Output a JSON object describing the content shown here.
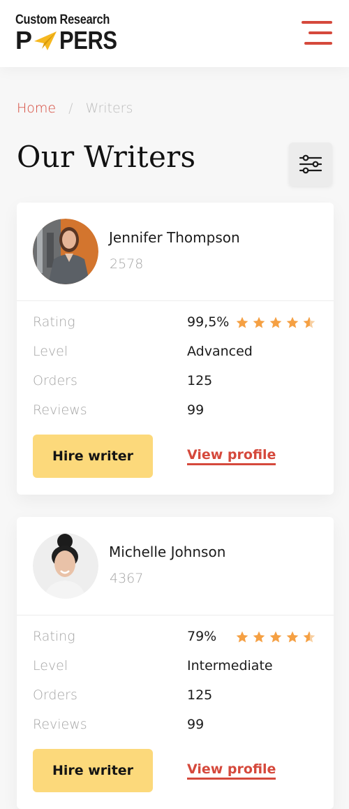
{
  "logo": {
    "line1": "Custom Research",
    "letter_p": "P",
    "rest": "PERS"
  },
  "breadcrumb": {
    "home": "Home",
    "separator": "/",
    "current": "Writers"
  },
  "page_title": "Our Writers",
  "colors": {
    "accent": "#d5493c",
    "button": "#fcd97b",
    "star": "#f5a043"
  },
  "writers": [
    {
      "name": "Jennifer Thompson",
      "id": "2578",
      "stats": {
        "rating_label": "Rating",
        "rating": "99,5%",
        "level_label": "Level",
        "level": "Advanced",
        "orders_label": "Orders",
        "orders": "125",
        "reviews_label": "Reviews",
        "reviews": "99"
      },
      "stars": 4.5,
      "hire_label": "Hire writer",
      "profile_label": "View profile"
    },
    {
      "name": "Michelle Johnson",
      "id": "4367",
      "stats": {
        "rating_label": "Rating",
        "rating": "79%",
        "level_label": "Level",
        "level": "Intermediate",
        "orders_label": "Orders",
        "orders": "125",
        "reviews_label": "Reviews",
        "reviews": "99"
      },
      "stars": 4.5,
      "hire_label": "Hire writer",
      "profile_label": "View profile"
    }
  ]
}
